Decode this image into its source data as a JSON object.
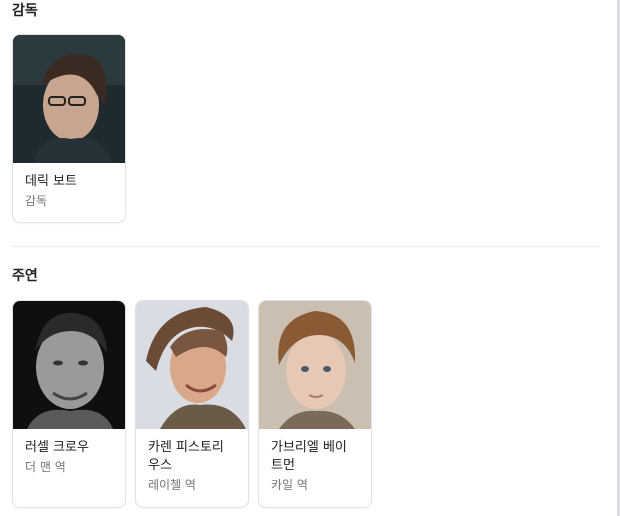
{
  "sections": {
    "directors": {
      "title": "감독",
      "people": [
        {
          "name": "데릭 보트",
          "role": "감독"
        }
      ]
    },
    "cast": {
      "title": "주연",
      "people": [
        {
          "name": "러셀 크로우",
          "role": "더 맨 역"
        },
        {
          "name": "카렌 피스토리우스",
          "name_lines": [
            "카렌 피스토리",
            "우스"
          ],
          "role": "레이첼 역"
        },
        {
          "name": "가브리엘 베이트먼",
          "name_lines": [
            "가브리엘 베이",
            "트먼"
          ],
          "role": "카일 역"
        }
      ]
    }
  }
}
